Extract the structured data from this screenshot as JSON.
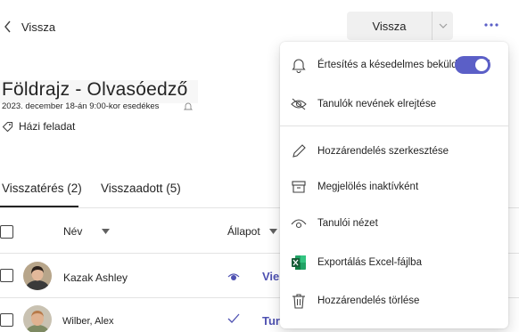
{
  "header": {
    "back_label": "Vissza",
    "primary_button_label": "Vissza"
  },
  "assignment": {
    "title": "Földrajz - Olvasóedző",
    "due": "2023. december 18-án 9:00-kor esedékes",
    "category": "Házi feladat"
  },
  "tabs": [
    {
      "label": "Visszatérés (2)",
      "selected": true
    },
    {
      "label": "Visszaadott (5)",
      "selected": false
    }
  ],
  "table": {
    "columns": {
      "name": "Név",
      "status": "Állapot"
    },
    "rows": [
      {
        "name": "Kazak Ashley",
        "status": "Vie",
        "status_icon": "eye-icon"
      },
      {
        "name": "Wilber, Alex",
        "status": "Turned in",
        "status_icon": "check-icon"
      }
    ]
  },
  "menu": {
    "items": [
      {
        "label": "Értesítés a késedelmes beküldésekről",
        "icon": "bell-icon",
        "toggle_on": true
      },
      {
        "label": "Tanulók nevének elrejtése",
        "icon": "eye-off-icon"
      },
      {
        "label": "Hozzárendelés szerkesztése",
        "icon": "pencil-icon"
      },
      {
        "label": "Megjelölés inaktívként",
        "icon": "archive-icon"
      },
      {
        "label": "Tanulói nézet",
        "icon": "eye-icon"
      },
      {
        "label": "Exportálás Excel-fájlba",
        "icon": "excel-icon"
      },
      {
        "label": "Hozzárendelés törlése",
        "icon": "trash-icon"
      }
    ]
  },
  "colors": {
    "accent": "#5b5fc7",
    "status_text": "#4f52b2"
  }
}
